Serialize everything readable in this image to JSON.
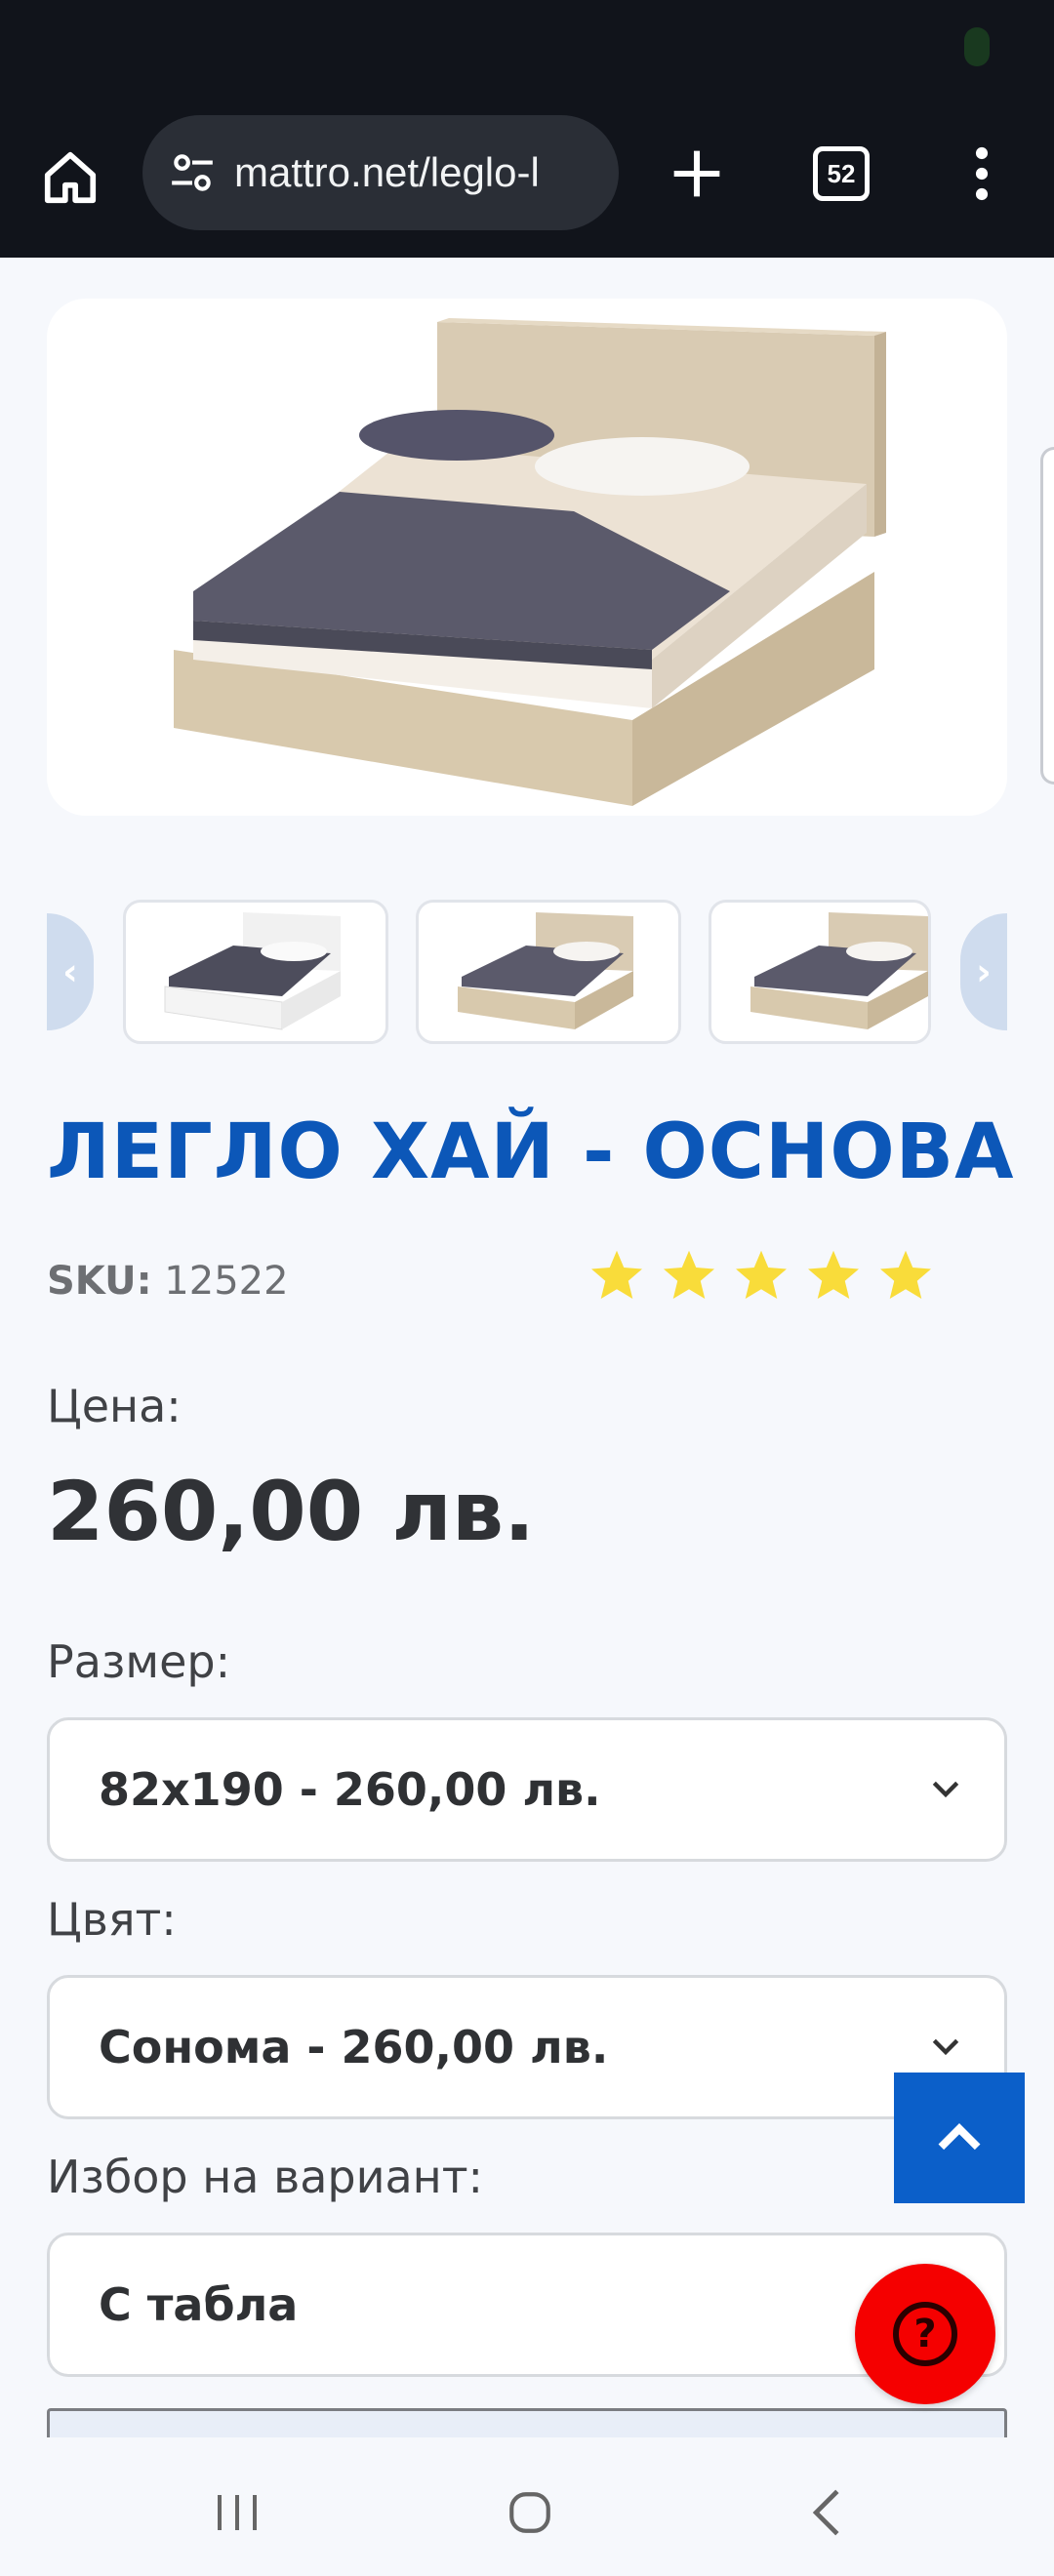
{
  "browser": {
    "url": "mattro.net/leglo-l",
    "tab_count": "52"
  },
  "product": {
    "title": "ЛЕГЛО ХАЙ - ОСНОВА",
    "sku_label": "SKU:",
    "sku_value": "12522",
    "rating": 5,
    "rating_max": 5,
    "price_label": "Цена:",
    "price": "260,00 лв."
  },
  "options": {
    "size_label": "Размер:",
    "size_value": "82x190 - 260,00 лв.",
    "color_label": "Цвят:",
    "color_value": "Сонома - 260,00 лв.",
    "variant_label": "Избор на вариант:",
    "variant_value": "С табла"
  },
  "colors": {
    "accent": "#0c57b8",
    "star": "#f9dc3a",
    "scroll_top_button": "#0b5fc9",
    "help_button": "#f50000"
  },
  "icons": {
    "home": "home-icon",
    "site_settings": "tune-icon",
    "new_tab": "plus-icon",
    "tabs": "tab-switcher-icon",
    "menu": "more-vert-icon",
    "prev": "chevron-left-icon",
    "next": "chevron-right-icon",
    "dropdown": "chevron-down-icon",
    "scroll_top": "chevron-up-icon",
    "help": "help-icon",
    "recents": "recents-icon",
    "home_nav": "home-nav-icon",
    "back": "back-icon"
  }
}
